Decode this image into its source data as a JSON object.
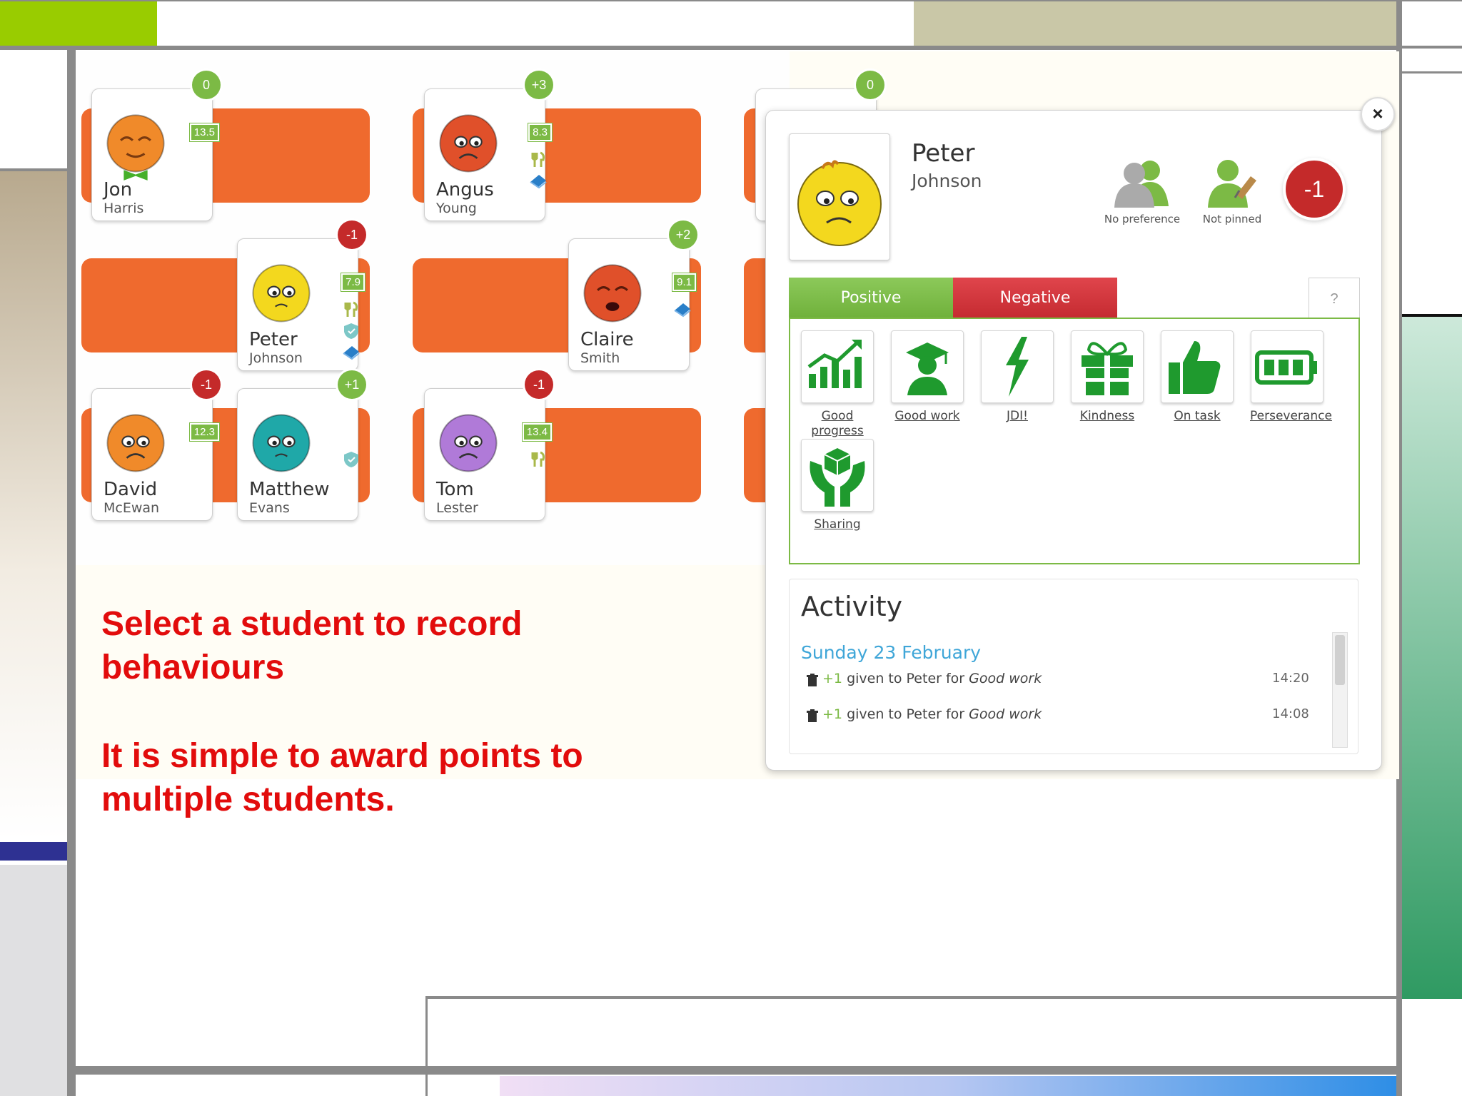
{
  "students": [
    {
      "first": "Jon",
      "last": "Harris",
      "score": "0",
      "score_type": "pos",
      "avg": "13.5",
      "face": "#f08a2a",
      "mood": "sleepy",
      "bowtie": true
    },
    {
      "first": "Angus",
      "last": "Young",
      "score": "+3",
      "score_type": "pos",
      "avg": "8.3",
      "face": "#e0502a",
      "mood": "sad",
      "icons": [
        "lunch",
        "book"
      ]
    },
    {
      "first": "Peter",
      "last": "Johnson",
      "score": "-1",
      "score_type": "neg",
      "avg": "7.9",
      "face": "#f3d81e",
      "mood": "worried",
      "icons": [
        "lunch",
        "shield",
        "book"
      ]
    },
    {
      "first": "Claire",
      "last": "Smith",
      "score": "+2",
      "score_type": "pos",
      "avg": "9.1",
      "face": "#e0502a",
      "mood": "crying",
      "icons": [
        "book"
      ]
    },
    {
      "first": "David",
      "last": "McEwan",
      "score": "-1",
      "score_type": "neg",
      "avg": "12.3",
      "face": "#f08a2a",
      "mood": "sad"
    },
    {
      "first": "Matthew",
      "last": "Evans",
      "score": "+1",
      "score_type": "pos",
      "avg": "",
      "face": "#1fa8a8",
      "mood": "worried",
      "icons": [
        "shield"
      ]
    },
    {
      "first": "Tom",
      "last": "Lester",
      "score": "-1",
      "score_type": "neg",
      "avg": "13.4",
      "face": "#b07ad8",
      "mood": "sad",
      "icons": [
        "lunch"
      ]
    }
  ],
  "partial_card_score": "0",
  "instructions": {
    "line1": "Select a student to record",
    "line2": "behaviours",
    "line3": "It is simple to award points to",
    "line4": "multiple students."
  },
  "modal": {
    "first_name": "Peter",
    "last_name": "Johnson",
    "score": "-1",
    "no_preference": "No preference",
    "not_pinned": "Not pinned",
    "close": "×",
    "tabs": {
      "positive": "Positive",
      "negative": "Negative",
      "help": "?"
    },
    "behaviours": [
      {
        "label": "Good",
        "label2": "progress",
        "icon": "chart-icon"
      },
      {
        "label": "Good work",
        "icon": "graduate-icon"
      },
      {
        "label": "JDI!",
        "icon": "lightning-icon"
      },
      {
        "label": "Kindness",
        "icon": "gift-icon"
      },
      {
        "label": "On task",
        "icon": "thumbs-up-icon"
      },
      {
        "label": "Perseverance",
        "icon": "battery-icon"
      },
      {
        "label": "Sharing",
        "icon": "hands-cube-icon"
      }
    ],
    "activity": {
      "title": "Activity",
      "date": "Sunday 23 February",
      "entries": [
        {
          "points": "+1",
          "text": "given to Peter for",
          "behaviour": "Good work",
          "time": "14:20"
        },
        {
          "points": "+1",
          "text": "given to Peter for",
          "behaviour": "Good work",
          "time": "14:08"
        }
      ]
    }
  },
  "colors": {
    "accent_green": "#7cba45",
    "negative_red": "#d22f35",
    "desk_orange": "#ef6a2e",
    "text_red": "#e20c0c"
  }
}
